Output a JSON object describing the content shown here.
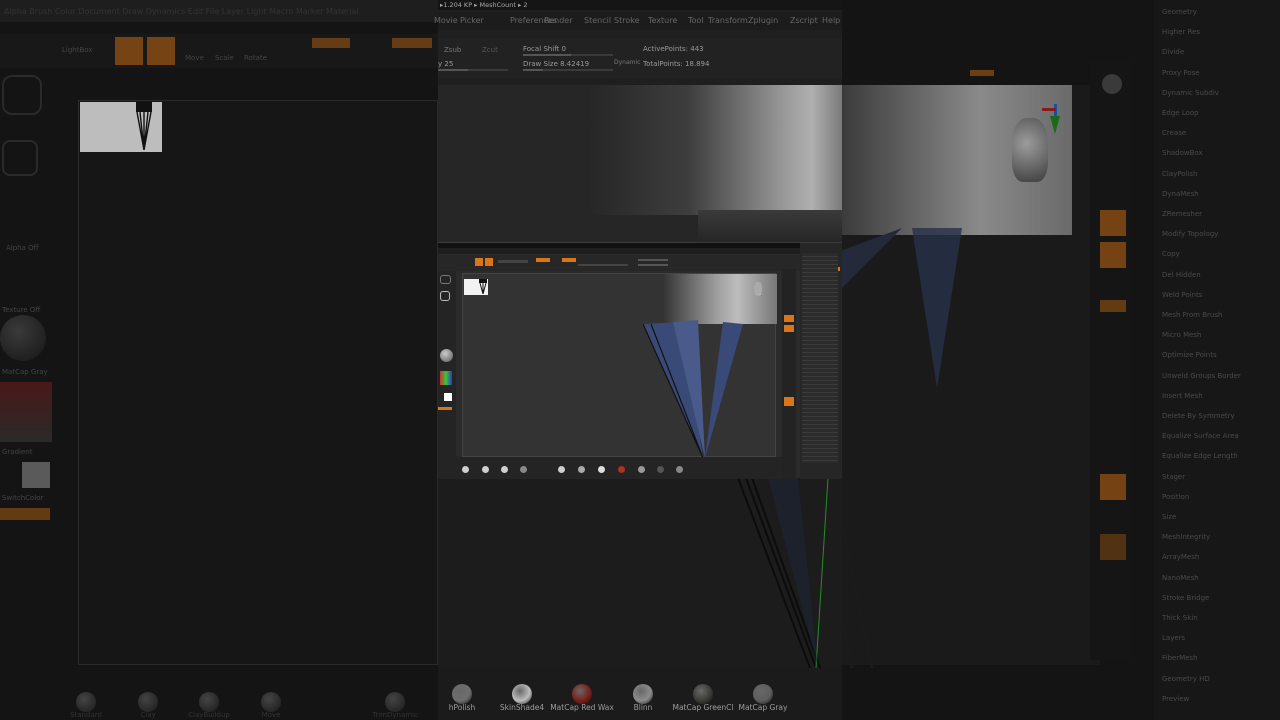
{
  "center": {
    "title_bar": "▸1.204 KP ▸ MeshCount ▸ 2",
    "menu_items": [
      "Movie",
      "Picker",
      "Preferences",
      "Render",
      "Stencil",
      "Stroke",
      "Texture",
      "Tool",
      "Transform",
      "Zplugin",
      "Zscript",
      "Help"
    ],
    "toolbar": {
      "zsub": "Zsub",
      "zcut": "Zcut",
      "focal_shift": "Focal Shift 0",
      "draw_size": "Draw Size 8.42419",
      "dynamic": "Dynamic",
      "active_points": "ActivePoints: 443",
      "total_points": "TotalPoints: 18.894",
      "z_intensity": "y 25"
    },
    "materials": [
      {
        "label": "hPolish",
        "color": "#6e6e6e"
      },
      {
        "label": "SkinShade4",
        "color": "#bdbdbd"
      },
      {
        "label": "MatCap Red Wax",
        "color": "#7a2018"
      },
      {
        "label": "Blinn",
        "color": "#8c8c8c"
      },
      {
        "label": "MatCap GreenCl",
        "color": "#3c3c34"
      },
      {
        "label": "MatCap Gray",
        "color": "#5e5e5e"
      }
    ]
  },
  "left_bg": {
    "menu": [
      "Alpha",
      "Brush",
      "Color",
      "Document",
      "Draw",
      "Dynamics",
      "Edit",
      "File",
      "Layer",
      "Light",
      "Macro",
      "Marker",
      "Material"
    ],
    "toolbar": [
      "LightBox",
      "Edit",
      "Draw",
      "Move",
      "Scale",
      "Rotate"
    ],
    "texts": [
      "Alpha Off",
      "Texture Off",
      "MatCap Gray",
      "Gradient",
      "SwitchColor"
    ],
    "bottom_materials": [
      "Standard",
      "Clay",
      "ClayBuildup",
      "Move",
      "TrimDynamic"
    ]
  },
  "right_bg": {
    "menu": [
      "Geometry",
      "Higher Res",
      "Divide",
      "Proxy Pose",
      "Dynamic Subdiv",
      "Edge Loop",
      "Crease",
      "ShadowBox",
      "ClayPolish",
      "DynaMesh",
      "ZRemesher",
      "Modify Topology",
      "Copy",
      "Del Hidden",
      "Weld Points",
      "Mesh From Brush",
      "Micro Mesh",
      "Optimize Points",
      "Unweld Groups Border",
      "Insert Mesh",
      "Delete By Symmetry",
      "Equalize Surface Area",
      "Equalize Edge Length",
      "Stager",
      "Position",
      "Size",
      "MeshIntegrity",
      "ArrayMesh",
      "NanoMesh",
      "Stroke Bridge",
      "Thick Skin",
      "Layers",
      "FiberMesh",
      "Geometry HD",
      "Preview"
    ]
  },
  "colors": {
    "accent": "#d9761a",
    "panel": "#1f1f1f",
    "background": "#0f0f0f"
  }
}
